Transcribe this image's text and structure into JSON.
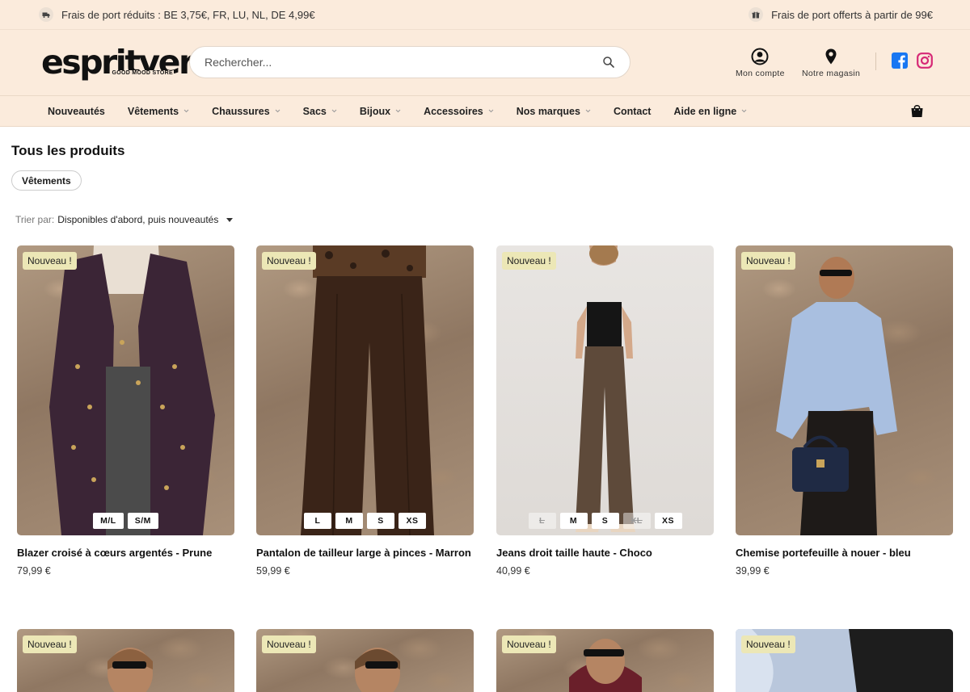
{
  "topbar": {
    "left_icon": "truck-icon",
    "left_text": "Frais de port réduits : BE 3,75€, FR, LU, NL, DE 4,99€",
    "right_icon": "gift-icon",
    "right_text": "Frais de port offerts à partir de 99€"
  },
  "header": {
    "logo_text": "espritvert.",
    "logo_tagline": "GOOD MOOD STORE",
    "search_placeholder": "Rechercher...",
    "account_label": "Mon compte",
    "store_label": "Notre magasin"
  },
  "nav": {
    "items": [
      {
        "label": "Nouveautés",
        "dropdown": false
      },
      {
        "label": "Vêtements",
        "dropdown": true
      },
      {
        "label": "Chaussures",
        "dropdown": true
      },
      {
        "label": "Sacs",
        "dropdown": true
      },
      {
        "label": "Bijoux",
        "dropdown": true
      },
      {
        "label": "Accessoires",
        "dropdown": true
      },
      {
        "label": "Nos marques",
        "dropdown": true
      },
      {
        "label": "Contact",
        "dropdown": false
      },
      {
        "label": "Aide en ligne",
        "dropdown": true
      }
    ]
  },
  "main": {
    "title": "Tous les produits",
    "filter_chip": "Vêtements",
    "sort_label": "Trier par:",
    "sort_value": "Disponibles d'abord, puis nouveautés"
  },
  "products": [
    {
      "badge": "Nouveau !",
      "name": "Blazer croisé à cœurs argentés - Prune",
      "price": "79,99 €",
      "sizes": [
        {
          "label": "M/L",
          "available": true
        },
        {
          "label": "S/M",
          "available": true
        }
      ]
    },
    {
      "badge": "Nouveau !",
      "name": "Pantalon de tailleur large à pinces - Marron",
      "price": "59,99 €",
      "sizes": [
        {
          "label": "L",
          "available": true
        },
        {
          "label": "M",
          "available": true
        },
        {
          "label": "S",
          "available": true
        },
        {
          "label": "XS",
          "available": true
        }
      ]
    },
    {
      "badge": "Nouveau !",
      "name": "Jeans droit taille haute - Choco",
      "price": "40,99 €",
      "sizes": [
        {
          "label": "L",
          "available": false
        },
        {
          "label": "M",
          "available": true
        },
        {
          "label": "S",
          "available": true
        },
        {
          "label": "XL",
          "available": false
        },
        {
          "label": "XS",
          "available": true
        }
      ]
    },
    {
      "badge": "Nouveau !",
      "name": "Chemise portefeuille à nouer - bleu",
      "price": "39,99 €",
      "sizes": []
    }
  ],
  "products_row2": [
    {
      "badge": "Nouveau !"
    },
    {
      "badge": "Nouveau !"
    },
    {
      "badge": "Nouveau !"
    },
    {
      "badge": "Nouveau !"
    }
  ],
  "colors": {
    "header_bg": "#fbebdc",
    "badge_bg": "#ece7b6",
    "facebook": "#1877f2",
    "instagram": "#d62976"
  }
}
